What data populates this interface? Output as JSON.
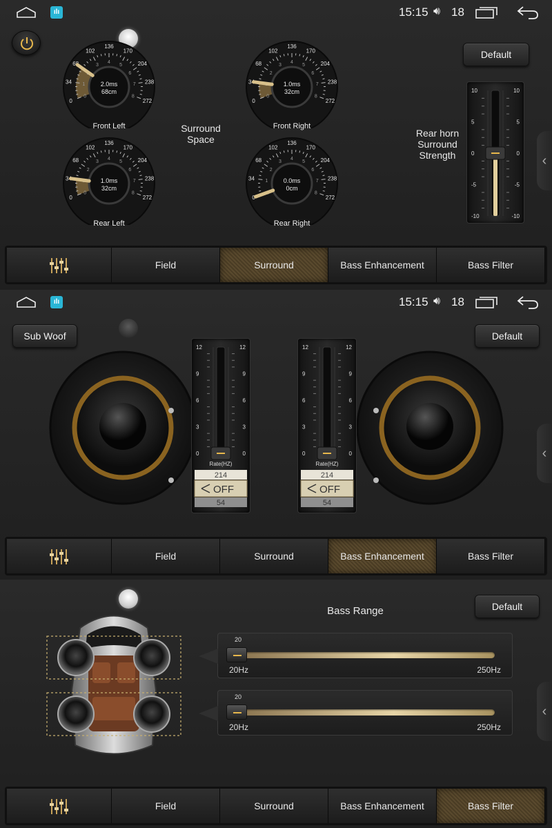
{
  "status": {
    "time": "15:15",
    "volume_icon": "speaker-icon",
    "volume": "18"
  },
  "accent_color": "#b88f42",
  "tabs": [
    "Field",
    "Surround",
    "Bass Enhancement",
    "Bass Filter"
  ],
  "surround": {
    "default_label": "Default",
    "center_label_1": "Surround",
    "center_label_2": "Space",
    "knob_outer_scale": [
      "0",
      "34",
      "68",
      "102",
      "136",
      "170",
      "204",
      "238",
      "272"
    ],
    "knob_inner_scale": [
      "0",
      "1",
      "2",
      "3",
      "4",
      "5",
      "6",
      "7",
      "8"
    ],
    "knobs": [
      {
        "label": "Front Left",
        "time": "2.0ms",
        "distance": "68cm",
        "level": 2
      },
      {
        "label": "Front Right",
        "time": "1.0ms",
        "distance": "32cm",
        "level": 1
      },
      {
        "label": "Rear Left",
        "time": "1.0ms",
        "distance": "32cm",
        "level": 1
      },
      {
        "label": "Rear Right",
        "time": "0.0ms",
        "distance": "0cm",
        "level": 0
      }
    ],
    "rear_horn_label": [
      "Rear horn",
      "Surround",
      "Strength"
    ],
    "rear_horn_scale": [
      "10",
      "5",
      "0",
      "-5",
      "-10"
    ],
    "rear_horn_value": 0
  },
  "bass_enhancement": {
    "sub_woof_label": "Sub Woof",
    "default_label": "Default",
    "scale": [
      "12",
      "9",
      "6",
      "3",
      "0"
    ],
    "rate_label": "Rate(HZ)",
    "rate_values": [
      "214",
      "OFF",
      "54"
    ],
    "left_gain": 0,
    "right_gain": 0
  },
  "bass_filter": {
    "title": "Bass Range",
    "default_label": "Default",
    "sliders": [
      {
        "value": "20",
        "min_label": "20Hz",
        "max_label": "250Hz"
      },
      {
        "value": "20",
        "min_label": "20Hz",
        "max_label": "250Hz"
      }
    ]
  }
}
